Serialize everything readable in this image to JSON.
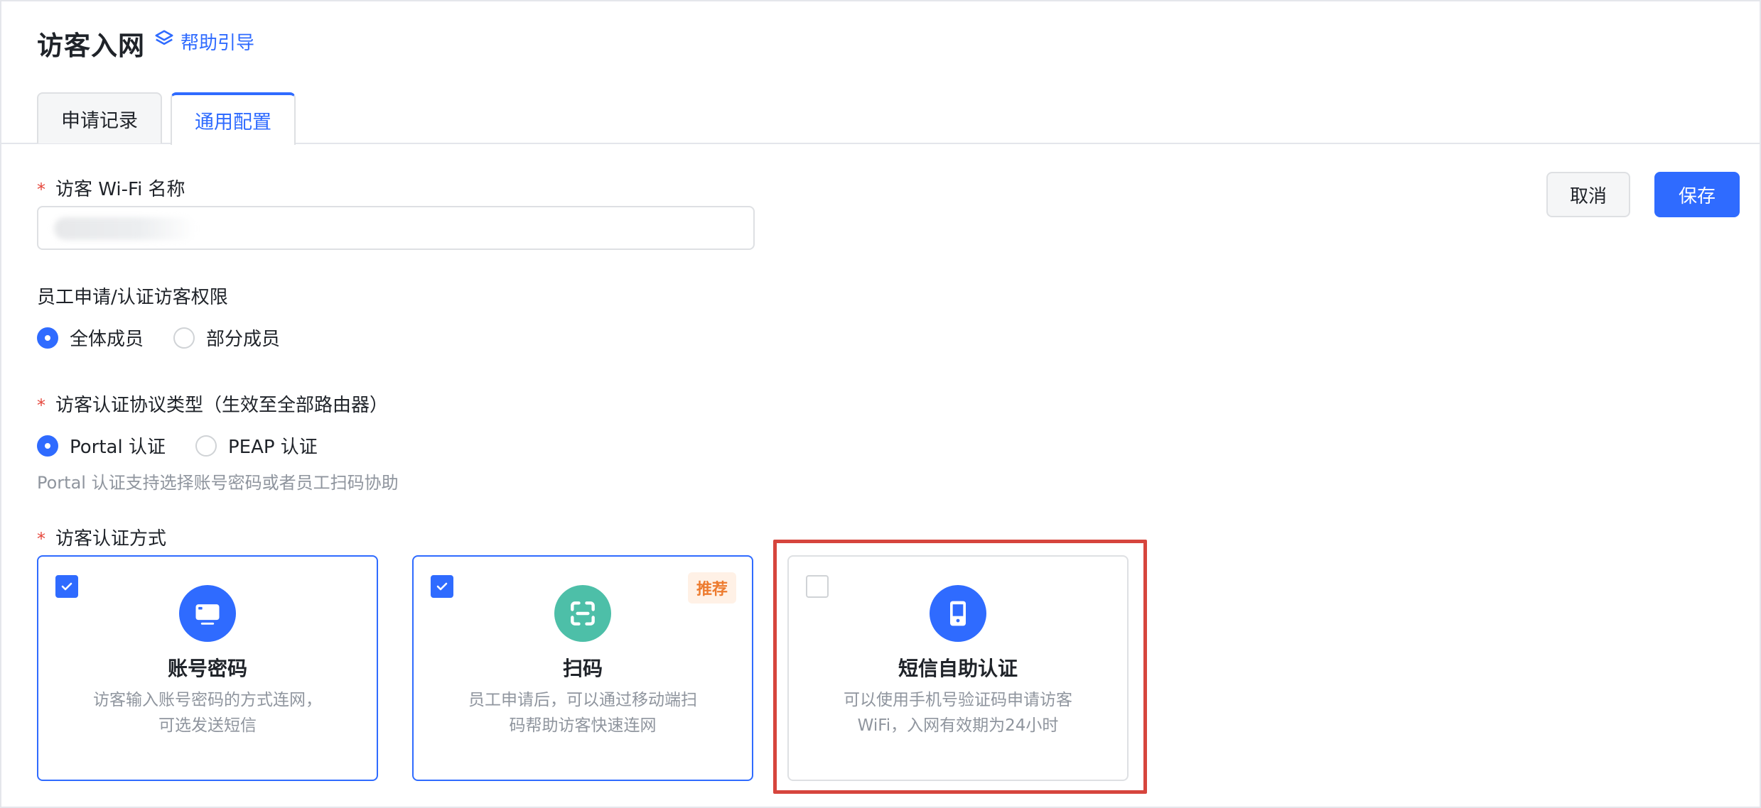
{
  "header": {
    "title": "访客入网",
    "help_label": "帮助引导"
  },
  "tabs": [
    {
      "label": "申请记录",
      "active": false
    },
    {
      "label": "通用配置",
      "active": true
    }
  ],
  "actions": {
    "cancel_label": "取消",
    "save_label": "保存"
  },
  "form": {
    "wifi_name": {
      "required": "*",
      "label": "访客 Wi-Fi 名称",
      "value": ""
    },
    "permission": {
      "label": "员工申请/认证访客权限",
      "options": [
        {
          "label": "全体成员",
          "checked": true
        },
        {
          "label": "部分成员",
          "checked": false
        }
      ]
    },
    "protocol": {
      "required": "*",
      "label": "访客认证协议类型（生效至全部路由器）",
      "options": [
        {
          "label": "Portal 认证",
          "checked": true
        },
        {
          "label": "PEAP 认证",
          "checked": false
        }
      ],
      "hint": "Portal 认证支持选择账号密码或者员工扫码协助"
    },
    "auth_methods": {
      "required": "*",
      "label": "访客认证方式",
      "cards": [
        {
          "title": "账号密码",
          "desc_line1": "访客输入账号密码的方式连网，",
          "desc_line2": "可选发送短信",
          "checked": true,
          "icon": "monitor-icon",
          "icon_color": "#2f6bff"
        },
        {
          "title": "扫码",
          "desc_line1": "员工申请后，可以通过移动端扫",
          "desc_line2": "码帮助访客快速连网",
          "checked": true,
          "badge": "推荐",
          "icon": "scan-icon",
          "icon_color": "#4dbfa8"
        },
        {
          "title": "短信自助认证",
          "desc_line1": "可以使用手机号验证码申请访客",
          "desc_line2": "WiFi，入网有效期为24小时",
          "checked": false,
          "icon": "phone-icon",
          "icon_color": "#2f6bff"
        }
      ]
    }
  },
  "colors": {
    "primary": "#2f6bff",
    "required": "#e5483d",
    "badge_text": "#ed7b2f",
    "highlight": "#d6453d"
  }
}
